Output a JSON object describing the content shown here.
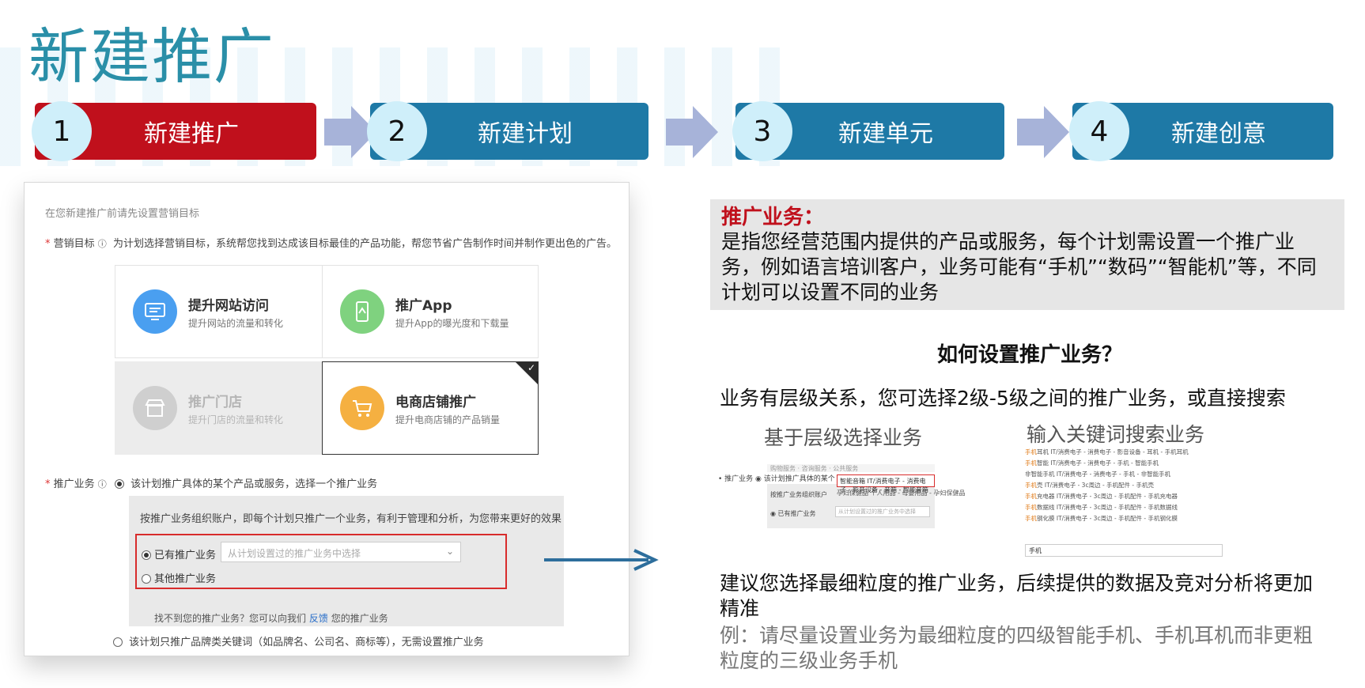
{
  "page": {
    "title": "新建推广"
  },
  "steps": [
    {
      "num": "1",
      "label": "新建推广",
      "color": "#c0101c"
    },
    {
      "num": "2",
      "label": "新建计划",
      "color": "#1e79a6"
    },
    {
      "num": "3",
      "label": "新建单元",
      "color": "#1e79a6"
    },
    {
      "num": "4",
      "label": "新建创意",
      "color": "#1e79a6"
    }
  ],
  "form": {
    "hint": "在您新建推广前请先设置营销目标",
    "goal_label": "营销目标",
    "goal_desc": "为计划选择营销目标，系统帮您找到达成该目标最佳的产品功能，帮您节省广告制作时间并制作更出色的广告。",
    "cards": [
      {
        "title": "提升网站访问",
        "subtitle": "提升网站的流量和转化",
        "icon": "monitor-icon",
        "color": "#4a9ff0",
        "state": "normal"
      },
      {
        "title": "推广App",
        "subtitle": "提升App的曝光度和下载量",
        "icon": "mobile-app-icon",
        "color": "#7fd27f",
        "state": "normal"
      },
      {
        "title": "推广门店",
        "subtitle": "提升门店的流量和转化",
        "icon": "store-icon",
        "color": "#c9c9c9",
        "state": "disabled"
      },
      {
        "title": "电商店铺推广",
        "subtitle": "提升电商店铺的产品销量",
        "icon": "cart-icon",
        "color": "#f5b041",
        "state": "selected"
      }
    ],
    "business_label": "推广业务",
    "business_option1": "该计划推广具体的某个产品或服务，选择一个推广业务",
    "business_desc": "按推广业务组织账户，即每个计划只推广一个业务，有利于管理和分析，为您带来更好的效果",
    "existing_label": "已有推广业务",
    "existing_placeholder": "从计划设置过的推广业务中选择",
    "other_label": "其他推广业务",
    "help_prefix": "找不到您的推广业务？您可以向我们",
    "help_link": "反馈",
    "help_suffix": "您的推广业务",
    "brand_option": "该计划只推广品牌类关键词（如品牌名、公司名、商标等），无需设置推广业务"
  },
  "info": {
    "title": "推广业务：",
    "body": "是指您经营范围内提供的产品或服务，每个计划需设置一个推广业务，例如语言培训客户，业务可能有“手机”“数码”“智能机”等，不同计划可以设置不同的业务"
  },
  "how": {
    "title": "如何设置推广业务？",
    "levels": "业务有层级关系，您可选择2级-5级之间的推广业务，或直接搜索",
    "left_sub": "基于层级选择业务",
    "right_sub": "输入关键词搜索业务"
  },
  "mini_left": {
    "row1": "购物服务 · 咨询服务 · 公共服务",
    "label": "• 推广业务 ◉ 该计划推广具体的某个",
    "highlight": "智能音箱  IT/消费电子 - 消费电子 - 影音设备 - 音箱 - 智能音箱",
    "row3": "孕妇保健品  个人用品 - 母婴用品 - 孕妇保健品",
    "group": "按推广业务组织账户",
    "existing": "◉ 已有推广业务",
    "select": "从计划设置过的推广业务中选择"
  },
  "mini_right": {
    "items": [
      {
        "hl": "手机",
        "rest": "耳机   IT/消费电子 - 消费电子 - 影音设备 - 耳机 - 手机耳机"
      },
      {
        "hl": "手机",
        "rest": "智能   IT/消费电子 - 消费电子 - 手机 - 智能手机"
      },
      {
        "hl": "",
        "rest": "非智能手机   IT/消费电子 - 消费电子 - 手机 - 非智能手机"
      },
      {
        "hl": "手机",
        "rest": "壳   IT/消费电子 - 3c周边 - 手机配件 - 手机壳"
      },
      {
        "hl": "手机",
        "rest": "充电器   IT/消费电子 - 3c周边 - 手机配件 - 手机充电器"
      },
      {
        "hl": "手机",
        "rest": "数据线   IT/消费电子 - 3c周边 - 手机配件 - 手机数据线"
      },
      {
        "hl": "手机",
        "rest": "钢化膜   IT/消费电子 - 3c周边 - 手机配件 - 手机钢化膜"
      }
    ],
    "input": "手机"
  },
  "suggest": "建议您选择最细粒度的推广业务，后续提供的数据及竞对分析将更加精准",
  "example": "例：请尽量设置业务为最细粒度的四级智能手机、手机耳机而非更粗粒度的三级业务手机"
}
